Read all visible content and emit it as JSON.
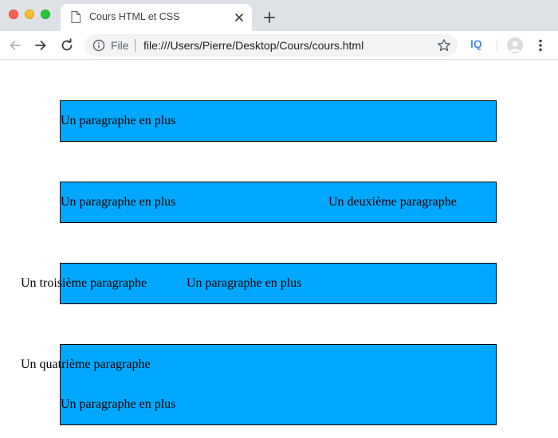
{
  "browser": {
    "tab_title": "Cours HTML et CSS",
    "scheme_label": "File",
    "url": "file:///Users/Pierre/Desktop/Cours/cours.html",
    "extension_label": "IQ"
  },
  "page": {
    "box_color": "#00a8ff",
    "section1": {
      "p_plus": "Un paragraphe en plus"
    },
    "section2": {
      "p_plus": "Un paragraphe en plus",
      "p_deuxieme": "Un deuxième paragraphe"
    },
    "section3": {
      "p_troisieme": "Un troisième paragraphe",
      "p_plus": "Un paragraphe en plus"
    },
    "section4": {
      "p_quatrieme": "Un quatrième paragraphe",
      "p_plus": "Un paragraphe en plus"
    }
  }
}
